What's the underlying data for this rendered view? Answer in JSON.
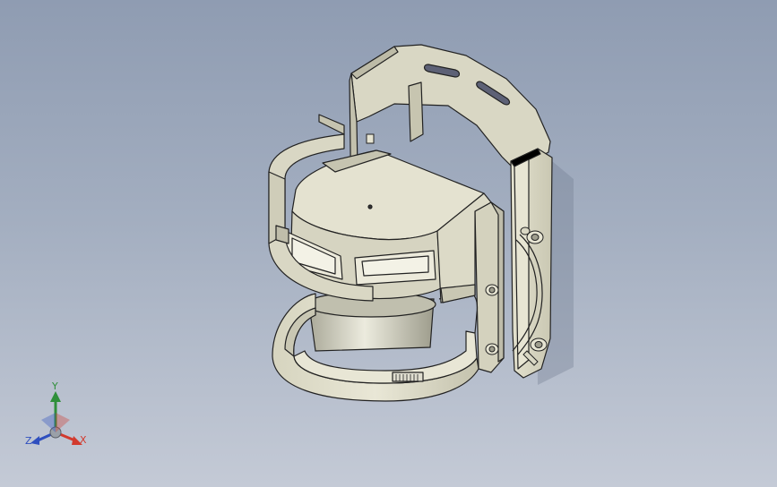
{
  "viewport": {
    "background_top": "#8f9cb2",
    "background_bottom": "#c4cad6",
    "model": {
      "part_color": "#dcdac6",
      "edge_color": "#222222",
      "shadow_color": "#7c869a"
    }
  },
  "triad": {
    "y_label": "Y",
    "x_label": "X",
    "z_label": "Z",
    "y_color": "#2f8f3a",
    "x_color": "#d23a2e",
    "z_color": "#2f4fbf"
  }
}
